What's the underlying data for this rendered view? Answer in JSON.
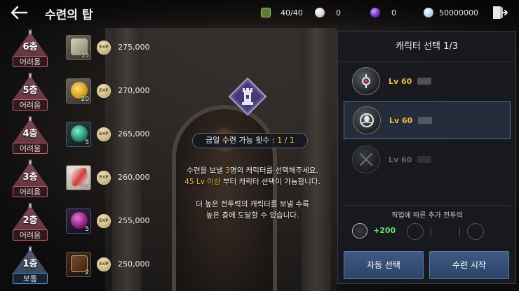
{
  "header": {
    "title": "수련의 탑"
  },
  "resources": {
    "stamina": "40/40",
    "pearl": "0",
    "gem": "0",
    "silver": "50000000"
  },
  "floors": [
    {
      "name": "6층",
      "difficulty": "어려움",
      "reward_qty": "15",
      "exp": "275,000",
      "item": "scroll"
    },
    {
      "name": "5층",
      "difficulty": "어려움",
      "reward_qty": "20",
      "exp": "270,000",
      "item": "pouch"
    },
    {
      "name": "4층",
      "difficulty": "어려움",
      "reward_qty": "5",
      "exp": "265,000",
      "item": "green-gem"
    },
    {
      "name": "3층",
      "difficulty": "어려움",
      "reward_qty": "18",
      "exp": "260,000",
      "item": "card"
    },
    {
      "name": "2층",
      "difficulty": "어려움",
      "reward_qty": "5",
      "exp": "255,000",
      "item": "purple-gem"
    },
    {
      "name": "1층",
      "difficulty": "보통",
      "reward_qty": "2",
      "exp": "250,000",
      "item": "book"
    }
  ],
  "center": {
    "count_label": "금일 수련 가능 횟수 :",
    "count_value": "1 / 1",
    "line1_pre": "수련을 보낼 ",
    "line1_num": "3",
    "line1_post": "명의 캐릭터를 선택해주세요.",
    "line2_gold": "45 Lv 이상",
    "line2_rest": " 부터 캐릭터 선택이 가능합니다.",
    "line3": "더 높은 전투력의 캐릭터를 보낼 수록",
    "line4": "높은 층에 도달할 수 있습니다."
  },
  "panel": {
    "title": "캐릭터 선택 1/3",
    "characters": [
      {
        "level": "Lv 60",
        "state": "normal"
      },
      {
        "level": "Lv 60",
        "state": "selected"
      },
      {
        "level": "Lv 60",
        "state": "disabled"
      }
    ],
    "bonus_label": "직업에 따른 추가 전투력",
    "bonus_value": "+200",
    "auto_button": "자동 선택",
    "start_button": "수련 시작"
  },
  "colors": {
    "accent_gold": "#f2b94a",
    "button_blue": "#2b4366",
    "hard_border": "#d05a63",
    "normal_border": "#5c9ad8"
  }
}
